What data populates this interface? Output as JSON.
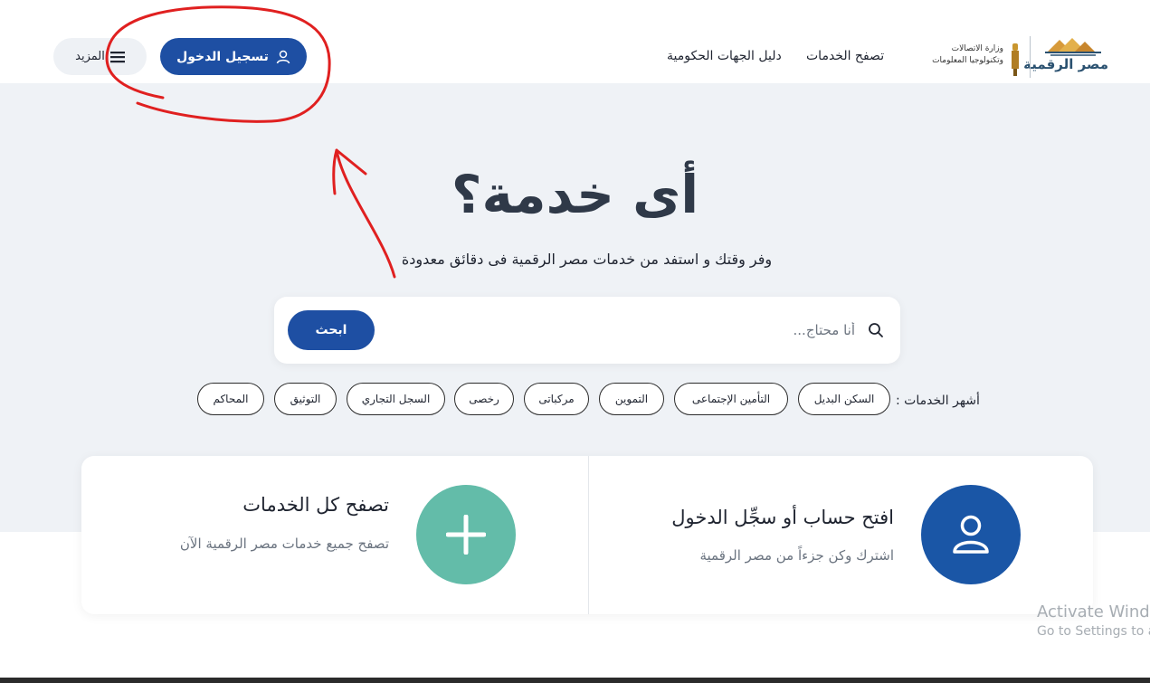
{
  "header": {
    "logo_text": "مصر الرقمية",
    "ministry_line1": "وزارة الاتصالات",
    "ministry_line2": "وتكنولوجيا المعلومات",
    "nav": {
      "browse_services": "تصفح الخدمات",
      "gov_directory": "دليل الجهات الحكومية"
    },
    "login_label": "تسجيل الدخول",
    "more_label": "المزيد",
    "colors": {
      "primary": "#1e4fa3",
      "logo": "#2a5170"
    }
  },
  "hero": {
    "title": "أى خدمة؟",
    "subtitle": "وفر وقتك و استفد من خدمات مصر الرقمية فى دقائق معدودة",
    "search": {
      "placeholder": "أنا محتاج...",
      "value": "",
      "button_label": "ابحث",
      "icon": "search-icon"
    },
    "popular_label": "أشهر الخدمات :",
    "popular_services": [
      "السكن البديل",
      "التأمين الإجتماعى",
      "التموين",
      "مركباتى",
      "رخصى",
      "السجل التجاري",
      "التوثيق",
      "المحاكم"
    ],
    "background": "#eff2f6"
  },
  "cards": [
    {
      "title": "افتح حساب أو سجِّل الدخول",
      "description": "اشترك وكن جزءاً من مصر الرقمية",
      "icon": "user-icon",
      "icon_color": "#1a56a6"
    },
    {
      "title": "تصفح كل الخدمات",
      "description": "تصفح جميع خدمات مصر الرقمية الآن",
      "icon": "plus-icon",
      "icon_color": "#63bca9"
    }
  ],
  "watermark": {
    "line1": "Activate Windo",
    "line2": "Go to Settings to a"
  },
  "annotation": {
    "color": "#e02020",
    "target": "login-button"
  }
}
